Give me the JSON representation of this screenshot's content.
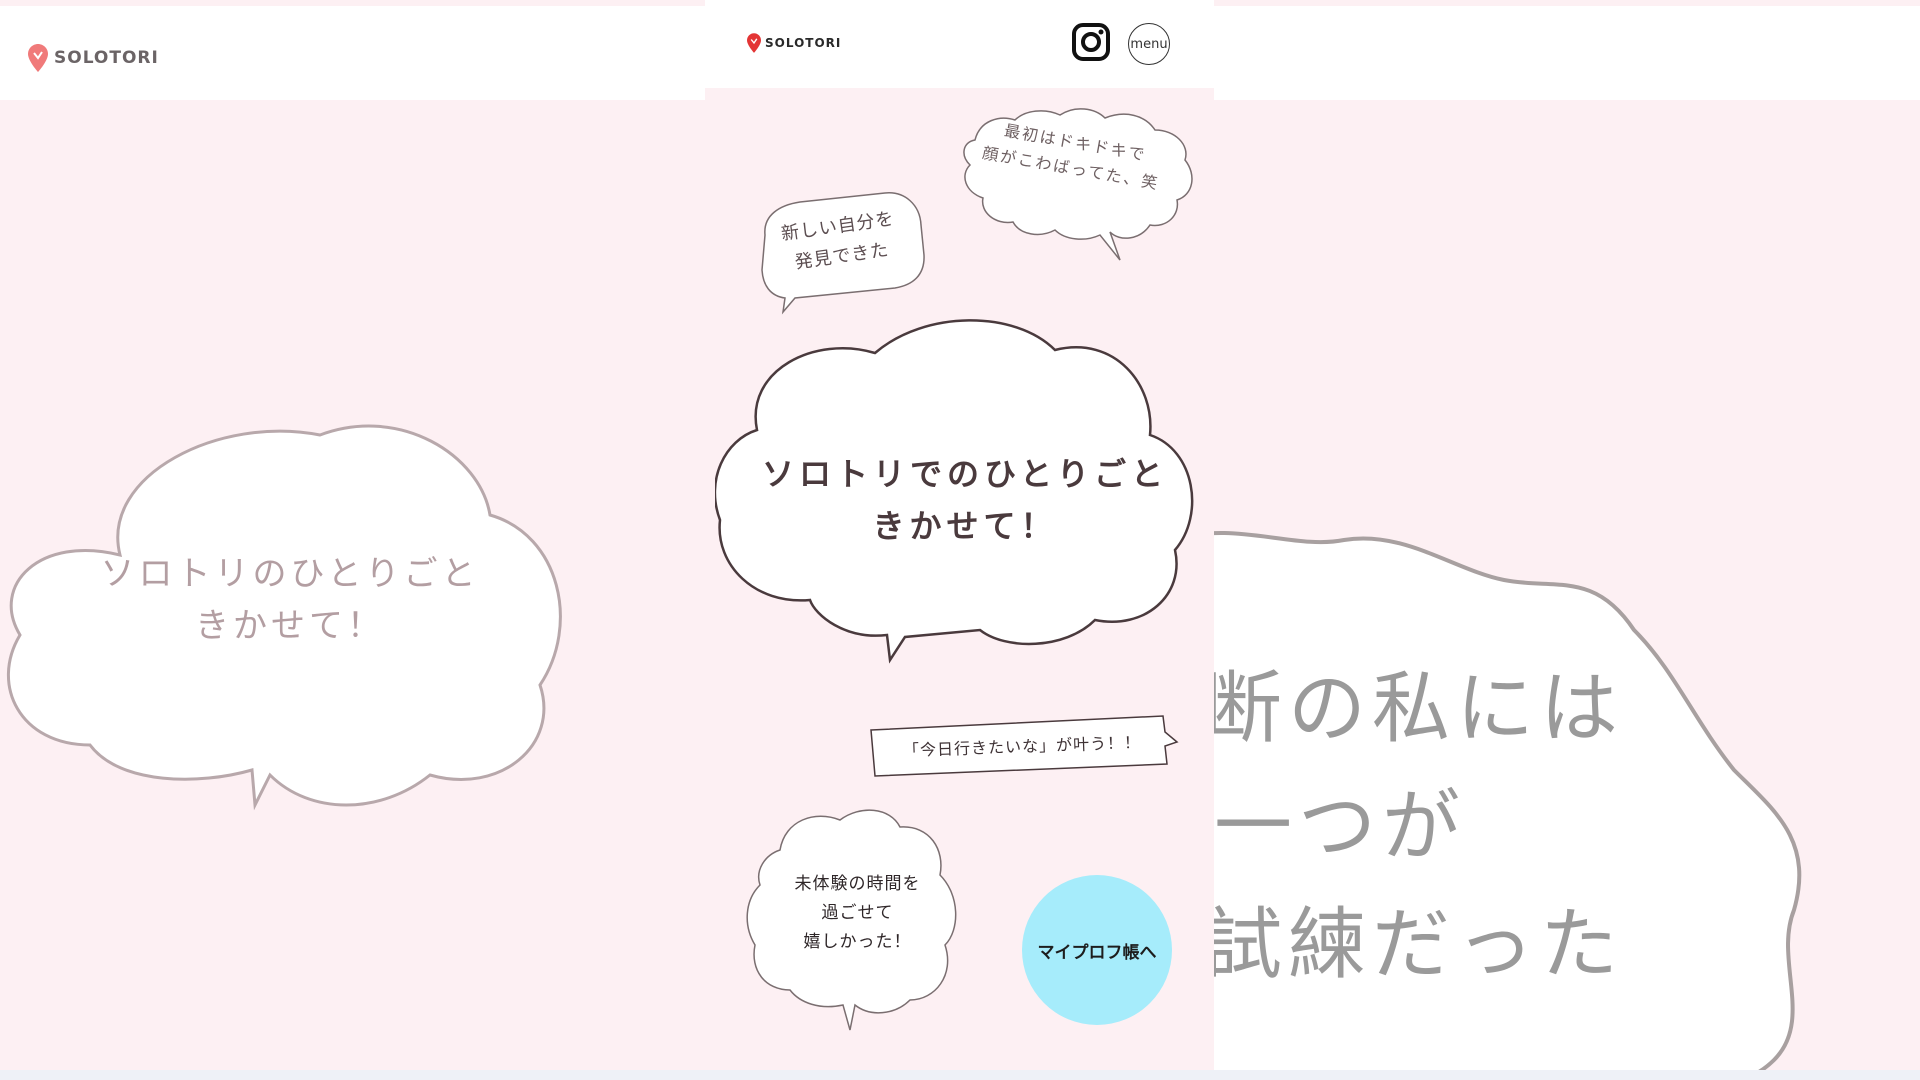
{
  "brand": {
    "name": "SOLOTORI",
    "accent": "#f06a6a",
    "pink_bg": "#fdf0f3"
  },
  "header": {
    "instagram_icon": "instagram-icon",
    "menu_label": "menu"
  },
  "bubbles": {
    "b1_lines": [
      "最初はドキドキで",
      "顔がこわばってた、笑"
    ],
    "b2_lines": [
      "新しい自分を",
      "発見できた"
    ],
    "main_lines": [
      "ソロトリでのひとりごと",
      "きかせて！"
    ],
    "b4_line": "「今日行きたいな」が叶う！！",
    "b5_lines": [
      "未体験の時間を",
      "過ごせて",
      "嬉しかった！"
    ]
  },
  "cta": {
    "label": "マイプロフ帳へ",
    "color": "#a6ecfb"
  },
  "background_left": {
    "cloud_lines": [
      "ソロトリのひとりごと",
      "きかせて！"
    ]
  },
  "background_right": {
    "big_lines": [
      "断の私には",
      "一つが",
      "試練だった"
    ]
  }
}
